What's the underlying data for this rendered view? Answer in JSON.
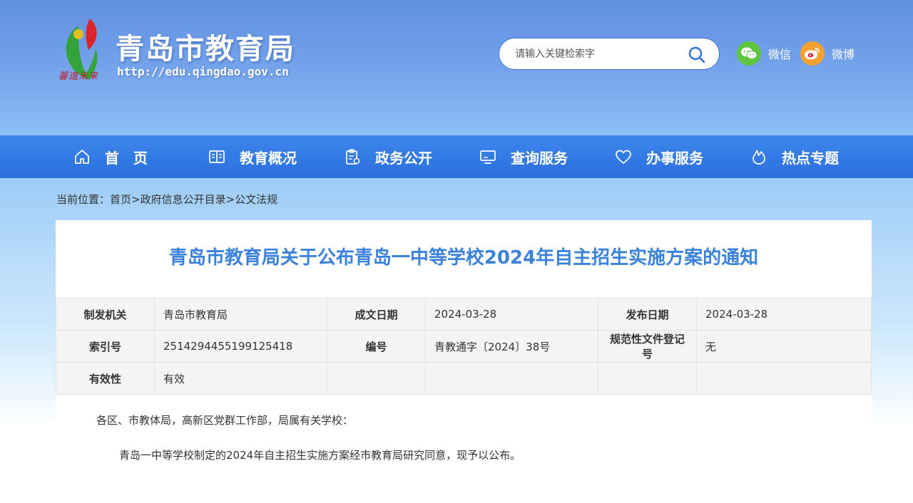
{
  "header": {
    "title": "青岛市教育局",
    "url": "http://edu.qingdao.gov.cn",
    "motto": "馨逸未来",
    "search_placeholder": "请输入关键检索字",
    "social": [
      {
        "label": "微信",
        "icon": "wechat-icon"
      },
      {
        "label": "微博",
        "icon": "weibo-icon"
      }
    ]
  },
  "nav": [
    {
      "label": "首　页",
      "icon": "home-icon"
    },
    {
      "label": "教育概况",
      "icon": "book-icon"
    },
    {
      "label": "政务公开",
      "icon": "clipboard-icon"
    },
    {
      "label": "查询服务",
      "icon": "monitor-icon"
    },
    {
      "label": "办事服务",
      "icon": "heart-icon"
    },
    {
      "label": "热点专题",
      "icon": "flame-icon"
    }
  ],
  "breadcrumb": "当前位置：首页>政府信息公开目录>公文法规",
  "article": {
    "title": "青岛市教育局关于公布青岛一中等学校2024年自主招生实施方案的通知",
    "meta": {
      "rows": [
        [
          {
            "key": "制发机关",
            "value": "青岛市教育局"
          },
          {
            "key": "成文日期",
            "value": "2024-03-28"
          },
          {
            "key": "发布日期",
            "value": "2024-03-28"
          }
        ],
        [
          {
            "key": "索引号",
            "value": "2514294455199125418"
          },
          {
            "key": "编号",
            "value": "青教通字〔2024〕38号"
          },
          {
            "key": "规范性文件登记号",
            "value": "无"
          }
        ],
        [
          {
            "key": "有效性",
            "value": "有效"
          },
          {
            "key": "",
            "value": ""
          },
          {
            "key": "",
            "value": ""
          }
        ]
      ]
    },
    "paragraphs": [
      "各区、市教体局，高新区党群工作部，局属有关学校：",
      "青岛一中等学校制定的2024年自主招生实施方案经市教育局研究同意，现予以公布。"
    ]
  },
  "colors": {
    "nav_bg": "#2f75e0",
    "title_blue": "#3a82db",
    "wechat_green": "#5ec53f",
    "weibo_orange": "#f5a030"
  }
}
